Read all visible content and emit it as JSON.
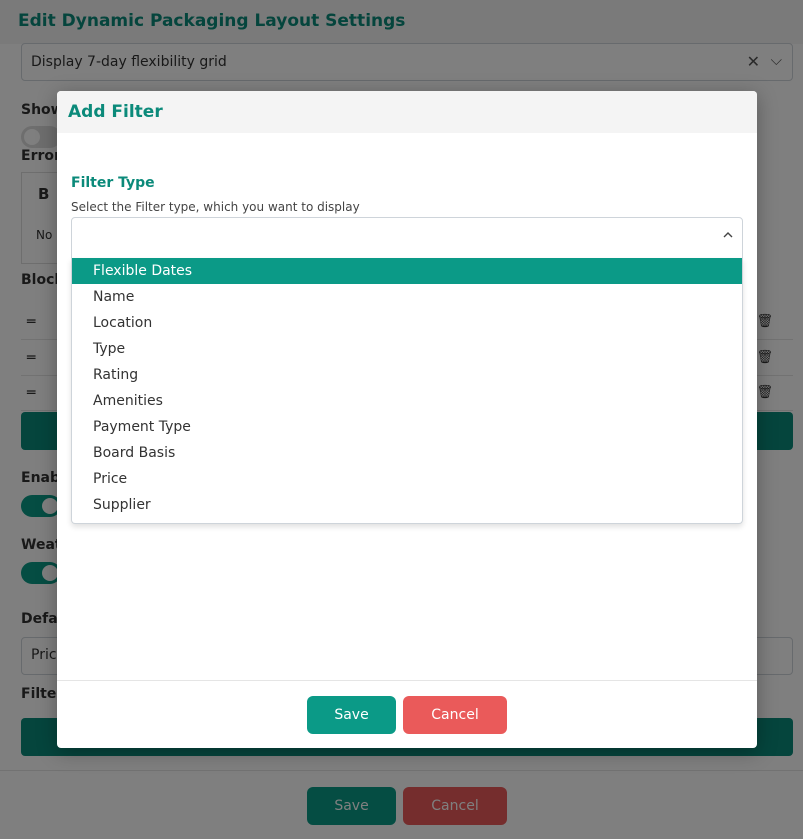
{
  "background": {
    "title": "Edit Dynamic Packaging Layout Settings",
    "top_select_value": "Display 7-day flexibility grid",
    "labels": {
      "show": "Show",
      "error": "Error",
      "blocks": "Block",
      "enable": "Enab",
      "weather": "Weat",
      "default": "Defa",
      "filter": "Filter"
    },
    "table_header": "B",
    "table_cell": "No",
    "drag_glyph": "═",
    "trash_glyph": "🗑",
    "default_select_value": "Pric",
    "footer": {
      "save_label": "Save",
      "cancel_label": "Cancel"
    }
  },
  "modal": {
    "title": "Add Filter",
    "field_label": "Filter Type",
    "field_help": "Select the Filter type, which you want to display",
    "selected_value": "",
    "options": [
      {
        "label": "Flexible Dates",
        "highlighted": true
      },
      {
        "label": "Name"
      },
      {
        "label": "Location"
      },
      {
        "label": "Type"
      },
      {
        "label": "Rating"
      },
      {
        "label": "Amenities"
      },
      {
        "label": "Payment Type"
      },
      {
        "label": "Board Basis"
      },
      {
        "label": "Price"
      },
      {
        "label": "Supplier"
      }
    ],
    "footer": {
      "save_label": "Save",
      "cancel_label": "Cancel"
    }
  },
  "colors": {
    "accent": "#0b9a87",
    "title": "#0b8a7a",
    "danger": "#ea5a5a"
  }
}
